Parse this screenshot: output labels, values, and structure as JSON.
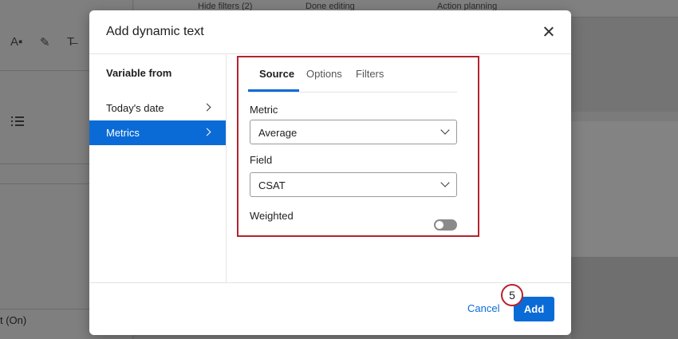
{
  "background": {
    "toolbar": [
      "Hide filters (2)",
      "Done editing",
      "Action planning"
    ],
    "status_text": "t (On)"
  },
  "modal": {
    "title": "Add dynamic text",
    "sidebar": {
      "heading": "Variable from",
      "items": [
        {
          "label": "Today's date",
          "active": false
        },
        {
          "label": "Metrics",
          "active": true
        }
      ]
    },
    "tabs": [
      {
        "label": "Source",
        "active": true
      },
      {
        "label": "Options",
        "active": false
      },
      {
        "label": "Filters",
        "active": false
      }
    ],
    "metric": {
      "label": "Metric",
      "value": "Average"
    },
    "field": {
      "label": "Field",
      "value": "CSAT"
    },
    "weighted": {
      "label": "Weighted",
      "on": false
    },
    "footer": {
      "cancel_label": "Cancel",
      "add_label": "Add"
    },
    "step_badge": "5"
  },
  "colors": {
    "accent": "#0b6bd6",
    "highlight": "#b4232f"
  }
}
